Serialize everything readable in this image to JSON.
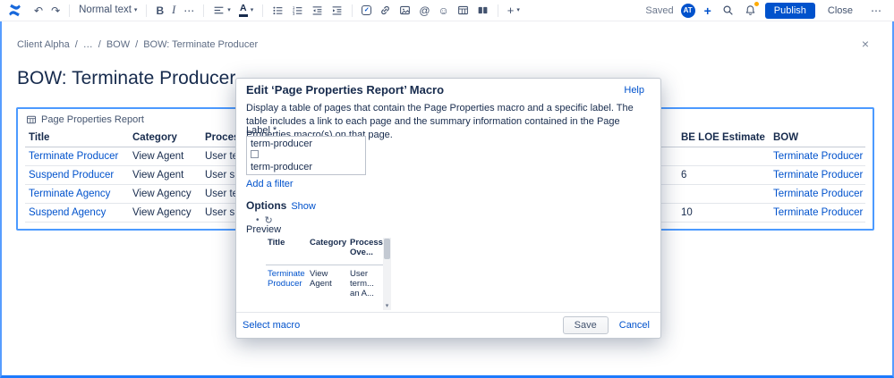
{
  "toolbar": {
    "undo": "↶",
    "redo": "↷",
    "text_style": "Normal text",
    "chevron": "▾",
    "bold": "B",
    "italic": "I",
    "more_format": "⋯",
    "action_check": "✓",
    "mention": "@",
    "emoji": "☺",
    "insert_plus": "+",
    "saved": "Saved",
    "avatar_initials": "AT",
    "create_plus": "+",
    "publish": "Publish",
    "close": "Close",
    "more_actions": "⋯"
  },
  "breadcrumb": {
    "items": [
      "Client Alpha",
      "…",
      "BOW",
      "BOW: Terminate Producer"
    ],
    "separator": "/",
    "close": "×"
  },
  "page": {
    "title": "BOW: Terminate Producer"
  },
  "macro_table": {
    "name": "Page Properties Report",
    "columns": [
      "Title",
      "Category",
      "Process Overview",
      "BE LOE Estimate",
      "BOW"
    ],
    "rows": [
      {
        "title": "Terminate Producer",
        "category": "View Agent",
        "process": "User termin",
        "estimate": "",
        "bow": "Terminate Producer"
      },
      {
        "title": "Suspend Producer",
        "category": "View Agent",
        "process": "User suspen",
        "estimate": "6",
        "bow": "Terminate Producer"
      },
      {
        "title": "Terminate Agency",
        "category": "View Agency",
        "process": "User termin",
        "estimate": "",
        "bow": "Terminate Producer"
      },
      {
        "title": "Suspend Agency",
        "category": "View Agency",
        "process": "User suspen",
        "estimate": "10",
        "bow": "Terminate Producer"
      }
    ]
  },
  "dialog": {
    "title": "Edit ‘Page Properties Report’ Macro",
    "help": "Help",
    "description": "Display a table of pages that contain the Page Properties macro and a specific label. The table includes a link to each page and the summary information contained in the Page Properties macro(s) on that page.",
    "label_field": "Label",
    "required_mark": "*",
    "label_value": "term-producer",
    "label_suggestion": "term-producer",
    "add_filter": "Add a filter",
    "options": "Options",
    "show": "Show",
    "bullet": "•",
    "refresh": "↻",
    "preview": "Preview",
    "preview_table": {
      "columns": [
        "Title",
        "Category",
        "Process Ove..."
      ],
      "row": {
        "title": "Terminate Producer",
        "category": "View Agent",
        "process": "User term... an A..."
      }
    },
    "select_macro": "Select macro",
    "save": "Save",
    "cancel": "Cancel",
    "scroll_down": "▾"
  }
}
